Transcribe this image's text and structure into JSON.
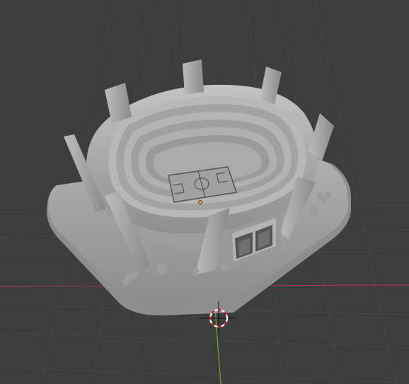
{
  "viewport": {
    "background": "#3d3d3d",
    "grid_color": "#474747",
    "x_axis_color": "#9c3c46",
    "y_axis_color": "#6f9a33",
    "model_color": "#a7a7a7",
    "cursor_colors": [
      "#cc2a2a",
      "#f2f2f2"
    ],
    "origin_color": "#f2a431"
  },
  "scene": {
    "object": "stadium-model",
    "pillar_count": 8,
    "stand_tiers": 7,
    "field_markings": "soccer-field"
  }
}
